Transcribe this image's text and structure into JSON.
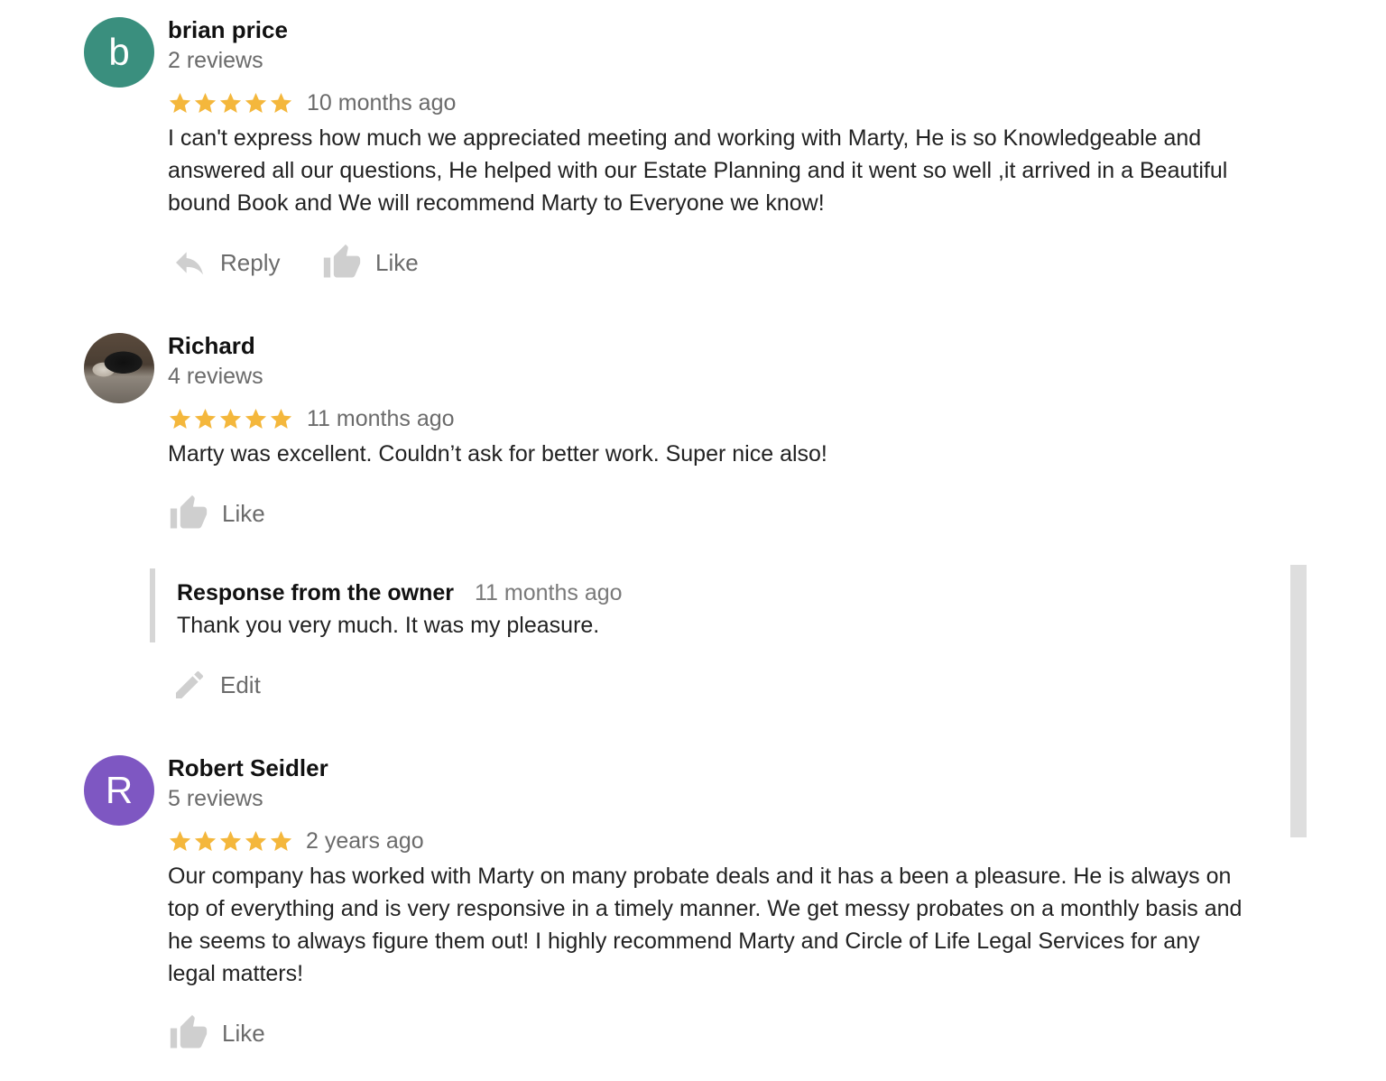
{
  "colors": {
    "star": "#f4b73c",
    "avatar_brian": "#3a8f7e",
    "avatar_robert": "#7e57c2",
    "muted_text": "#6b6b6b"
  },
  "reviews": [
    {
      "avatar_letter": "b",
      "name": "brian price",
      "review_count": "2 reviews",
      "rating": 5,
      "time": "10 months ago",
      "text": "I can't express how much we appreciated meeting and working with Marty, He is so Knowledgeable and answered all our questions, He helped with our Estate Planning and it went so well ,it arrived in a Beautiful bound Book and We will recommend Marty to Everyone we know!",
      "reply_label": "Reply",
      "like_label": "Like"
    },
    {
      "avatar_letter": "",
      "name": "Richard",
      "review_count": "4 reviews",
      "rating": 5,
      "time": "11 months ago",
      "text": "Marty was excellent. Couldn’t ask for better work. Super nice also!",
      "like_label": "Like",
      "owner_response": {
        "title": "Response from the owner",
        "time": "11 months ago",
        "text": "Thank you very much. It was my pleasure.",
        "edit_label": "Edit"
      }
    },
    {
      "avatar_letter": "R",
      "name": "Robert Seidler",
      "review_count": "5 reviews",
      "rating": 5,
      "time": "2 years ago",
      "text": "Our company has worked with Marty on many probate deals and it has a been a pleasure. He is always on top of everything and is very responsive in a timely manner. We get messy probates on a monthly basis and he seems to always figure them out! I highly recommend Marty and Circle of Life Legal Services for any legal matters!",
      "like_label": "Like"
    }
  ]
}
